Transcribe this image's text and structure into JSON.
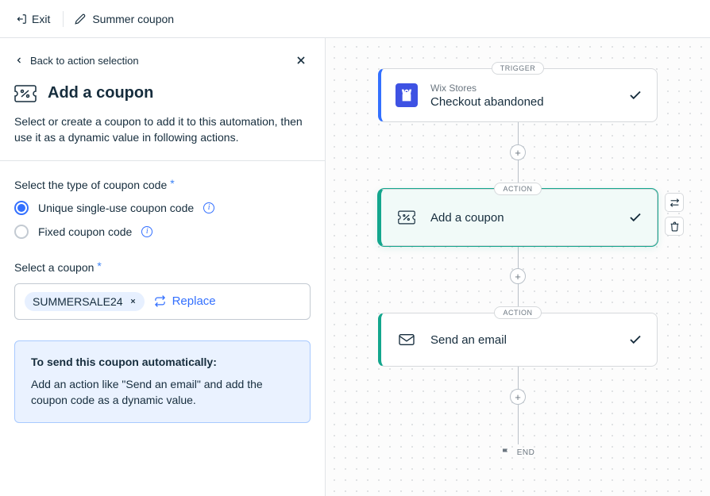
{
  "topbar": {
    "exit_label": "Exit",
    "title": "Summer coupon"
  },
  "panel": {
    "back_label": "Back to action selection",
    "title": "Add a coupon",
    "description": "Select or create a coupon to add it to this automation, then use it as a dynamic value in following actions.",
    "coupon_type_label": "Select the type of coupon code",
    "radio_unique": "Unique single-use coupon code",
    "radio_fixed": "Fixed coupon code",
    "select_coupon_label": "Select a coupon",
    "coupon_chip": "SUMMERSALE24",
    "replace_label": "Replace",
    "callout_title": "To send this coupon automatically:",
    "callout_body": "Add an action like \"Send an email\" and add the coupon code as a dynamic value."
  },
  "canvas": {
    "trigger_pill": "TRIGGER",
    "action_pill": "ACTION",
    "end_label": "END",
    "nodes": {
      "trigger": {
        "subtitle": "Wix Stores",
        "title": "Checkout abandoned"
      },
      "action1": {
        "title": "Add a coupon"
      },
      "action2": {
        "title": "Send an email"
      }
    }
  }
}
